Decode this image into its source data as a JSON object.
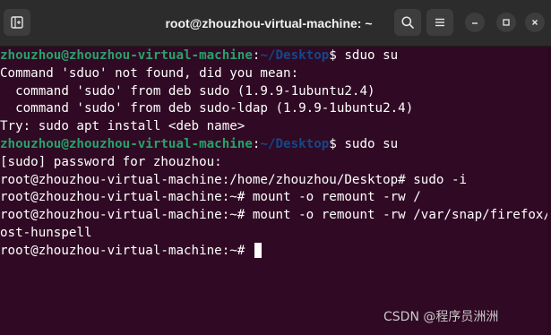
{
  "window": {
    "title": "root@zhouzhou-virtual-machine: ~"
  },
  "colors": {
    "background": "#300a24",
    "titlebar": "#2c2c2c",
    "user_host": "#26a269",
    "path": "#12488b",
    "text": "#ffffff"
  },
  "icons": {
    "new_tab": "new-tab-icon",
    "search": "search-icon",
    "menu": "hamburger-menu-icon",
    "minimize": "minimize-icon",
    "maximize": "maximize-icon",
    "close": "close-icon"
  },
  "terminal": {
    "lines": [
      {
        "user": "zhouzhou@zhouzhou-virtual-machine",
        "sep": ":",
        "path": "~/Desktop",
        "cmd": "$ sduo su"
      },
      {
        "text": "Command 'sduo' not found, did you mean:"
      },
      {
        "text": "  command 'sudo' from deb sudo (1.9.9-1ubuntu2.4)"
      },
      {
        "text": "  command 'sudo' from deb sudo-ldap (1.9.9-1ubuntu2.4)"
      },
      {
        "text": "Try: sudo apt install <deb name>"
      },
      {
        "user": "zhouzhou@zhouzhou-virtual-machine",
        "sep": ":",
        "path": "~/Desktop",
        "cmd": "$ sudo su"
      },
      {
        "text": "[sudo] password for zhouzhou:"
      },
      {
        "text": "root@zhouzhou-virtual-machine:/home/zhouzhou/Desktop# sudo -i"
      },
      {
        "text": "root@zhouzhou-virtual-machine:~# mount -o remount -rw /"
      },
      {
        "text": "root@zhouzhou-virtual-machine:~# mount -o remount -rw /var/snap/firefox/common/h"
      },
      {
        "text": "ost-hunspell"
      },
      {
        "text": "root@zhouzhou-virtual-machine:~# "
      }
    ]
  },
  "watermark": "CSDN @程序员洲洲"
}
